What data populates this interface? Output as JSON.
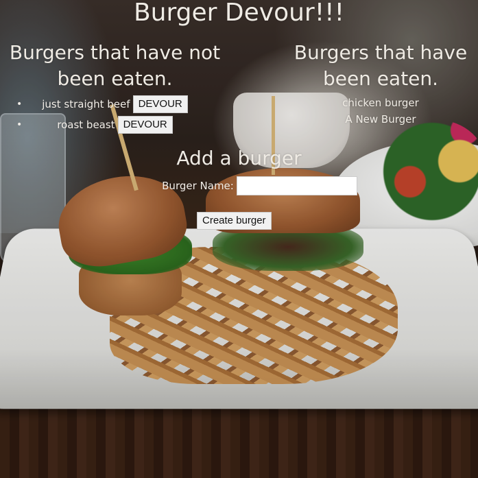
{
  "app": {
    "title": "Burger Devour!!!"
  },
  "uneaten": {
    "heading": "Burgers that have not been eaten.",
    "items": [
      {
        "name": "just straight beef",
        "button": "DEVOUR"
      },
      {
        "name": "roast beast",
        "button": "DEVOUR"
      }
    ]
  },
  "eaten": {
    "heading": "Burgers that have been eaten.",
    "items": [
      "chicken burger",
      "A New Burger"
    ]
  },
  "form": {
    "heading": "Add a burger",
    "label": "Burger Name:",
    "input_value": "",
    "submit_label": "Create burger"
  },
  "icons": {
    "list_bullet": "bullet-icon"
  }
}
